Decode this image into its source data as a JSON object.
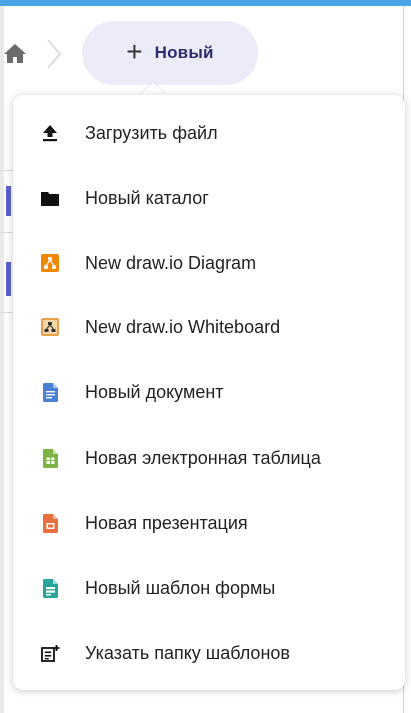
{
  "breadcrumb": {
    "home_icon": "home-icon"
  },
  "new_button": {
    "plus": "+",
    "label": "Новый"
  },
  "menu": {
    "items": [
      {
        "label": "Загрузить файл",
        "icon": "upload-icon",
        "color": "#111111"
      },
      {
        "label": "Новый каталог",
        "icon": "folder-icon",
        "color": "#111111"
      },
      {
        "label": "New draw.io Diagram",
        "icon": "drawio-diagram-icon",
        "color": "#f08705"
      },
      {
        "label": "New draw.io Whiteboard",
        "icon": "drawio-whiteboard-icon",
        "color": "#e8a04a"
      },
      {
        "label": "Новый документ",
        "icon": "document-icon",
        "color": "#4a7fd6"
      },
      {
        "label": "Новая электронная таблица",
        "icon": "spreadsheet-icon",
        "color": "#7cb342"
      },
      {
        "label": "Новая презентация",
        "icon": "presentation-icon",
        "color": "#e9703e"
      },
      {
        "label": "Новый шаблон формы",
        "icon": "form-template-icon",
        "color": "#26a69a"
      },
      {
        "label": "Указать папку шаблонов",
        "icon": "template-folder-icon",
        "color": "#111111"
      }
    ]
  }
}
